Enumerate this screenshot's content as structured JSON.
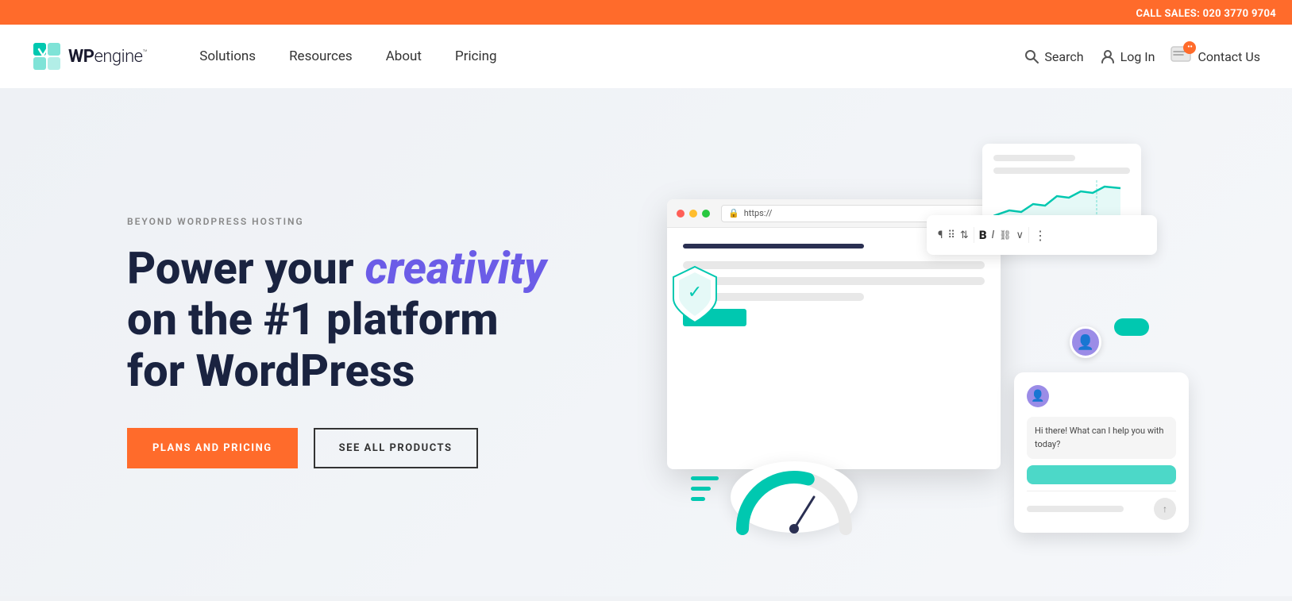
{
  "banner": {
    "text": "CALL SALES: 020 3770 9704",
    "label": "call-sales"
  },
  "header": {
    "logo": {
      "text_bold": "WP",
      "text_light": "engine",
      "trademark": "™"
    },
    "nav": {
      "solutions": "Solutions",
      "resources": "Resources",
      "about": "About",
      "pricing": "Pricing"
    },
    "actions": {
      "search": "Search",
      "login": "Log In",
      "contact": "Contact Us"
    }
  },
  "hero": {
    "subtitle": "BEYOND WORDPRESS HOSTING",
    "title_plain": "Power your ",
    "title_highlight": "creativity",
    "title_rest": "\non the #1 platform\nfor WordPress",
    "btn_primary": "PLANS AND PRICING",
    "btn_outline": "SEE ALL PRODUCTS"
  },
  "chat": {
    "message_agent": "Hi there! What can I help you with today?",
    "url": "https://"
  },
  "icons": {
    "search": "🔍",
    "user": "👤",
    "message": "💬",
    "shield": "🛡",
    "lock": "🔒",
    "send": "↑"
  }
}
